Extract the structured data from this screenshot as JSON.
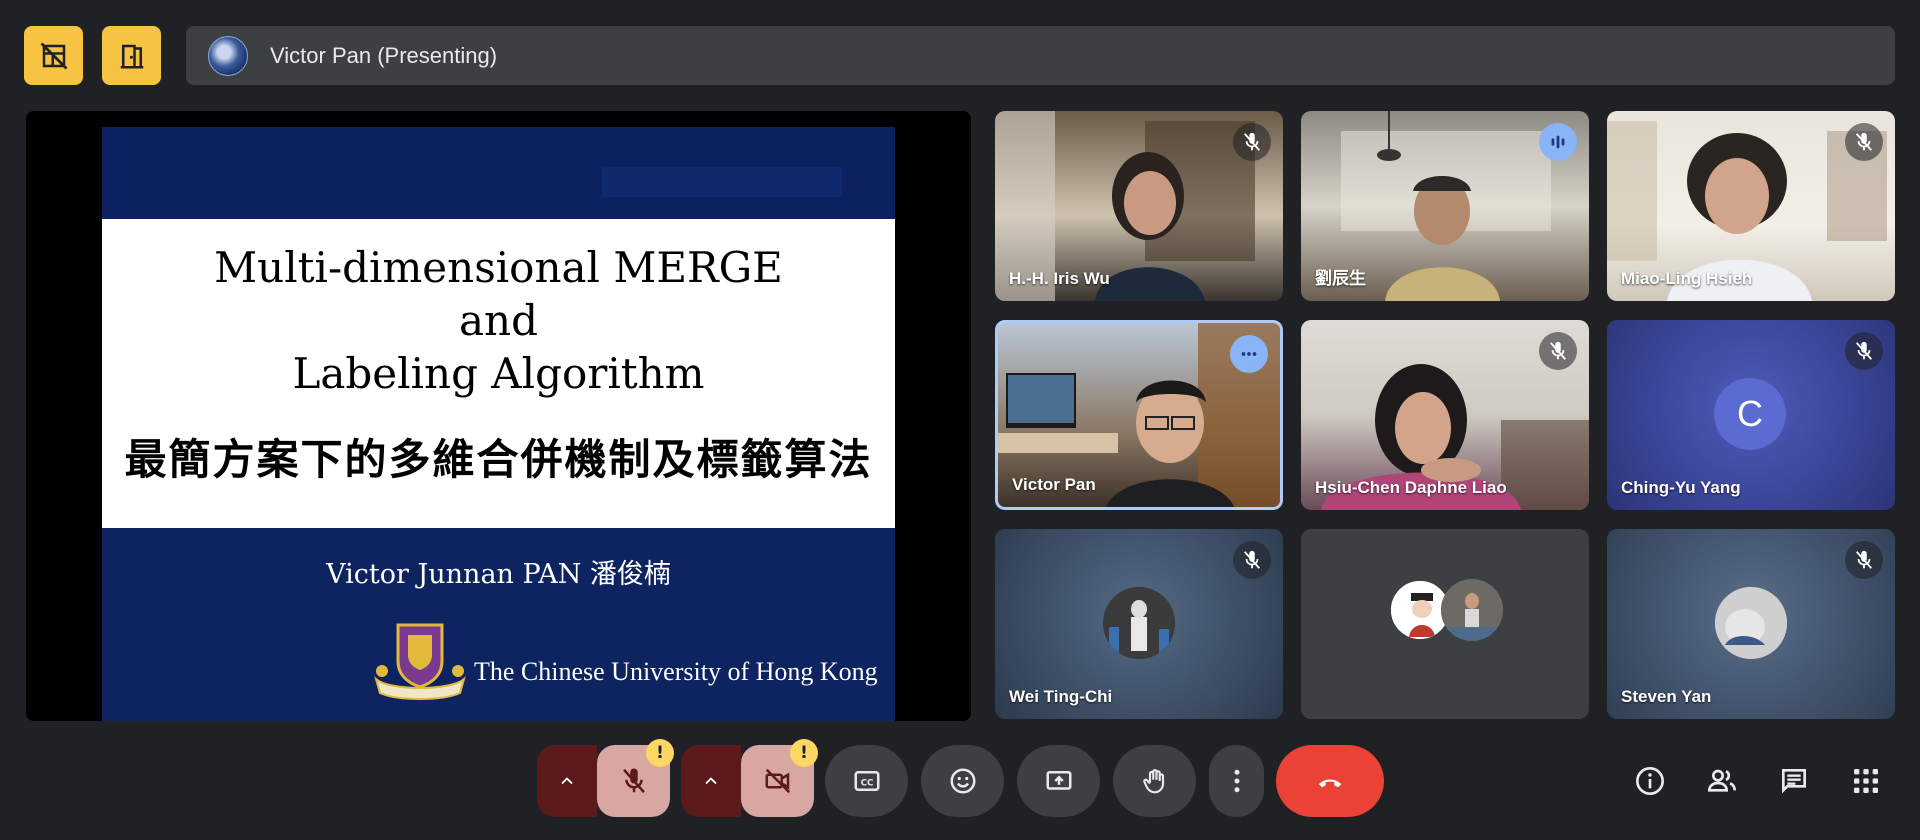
{
  "header": {
    "presenting_label": "Victor Pan (Presenting)",
    "left_buttons": [
      {
        "icon": "layout-off-icon"
      },
      {
        "icon": "door-exit-icon"
      }
    ]
  },
  "slide": {
    "title": "Multi-dimensional MERGE\nand\nLabeling Algorithm",
    "subtitle_zh": "最簡方案下的多維合併機制及標籤算法",
    "author": "Victor  Junnan PAN 潘俊楠",
    "university": "The Chinese University of Hong Kong"
  },
  "participants": [
    {
      "name": "H.-H. Iris Wu",
      "status": "muted"
    },
    {
      "name": "劉辰生",
      "status": "speaking"
    },
    {
      "name": "Miao-Ling Hsieh",
      "status": "muted"
    },
    {
      "name": "Victor Pan",
      "status": "more-options"
    },
    {
      "name": "Hsiu-Chen Daphne Liao",
      "status": "muted"
    },
    {
      "name": "Ching-Yu Yang",
      "status": "muted",
      "avatar_letter": "C"
    },
    {
      "name": "Wei Ting-Chi",
      "status": "muted"
    },
    {
      "name": "",
      "status": "none"
    },
    {
      "name": "Steven Yan",
      "status": "muted"
    }
  ],
  "controls": {
    "mic": {
      "state": "off",
      "warning": "!"
    },
    "camera": {
      "state": "off",
      "warning": "!"
    },
    "buttons": [
      "captions-icon",
      "emoji-icon",
      "present-screen-icon",
      "raise-hand-icon",
      "more-options-icon",
      "end-call-icon"
    ],
    "right": [
      "info-icon",
      "people-icon",
      "chat-icon",
      "activities-icon"
    ]
  },
  "colors": {
    "background": "#202124",
    "accent_yellow": "#f6c343",
    "end_call": "#ea4335",
    "speaking": "#8ab4f8",
    "slide_blue": "#0d2461"
  }
}
